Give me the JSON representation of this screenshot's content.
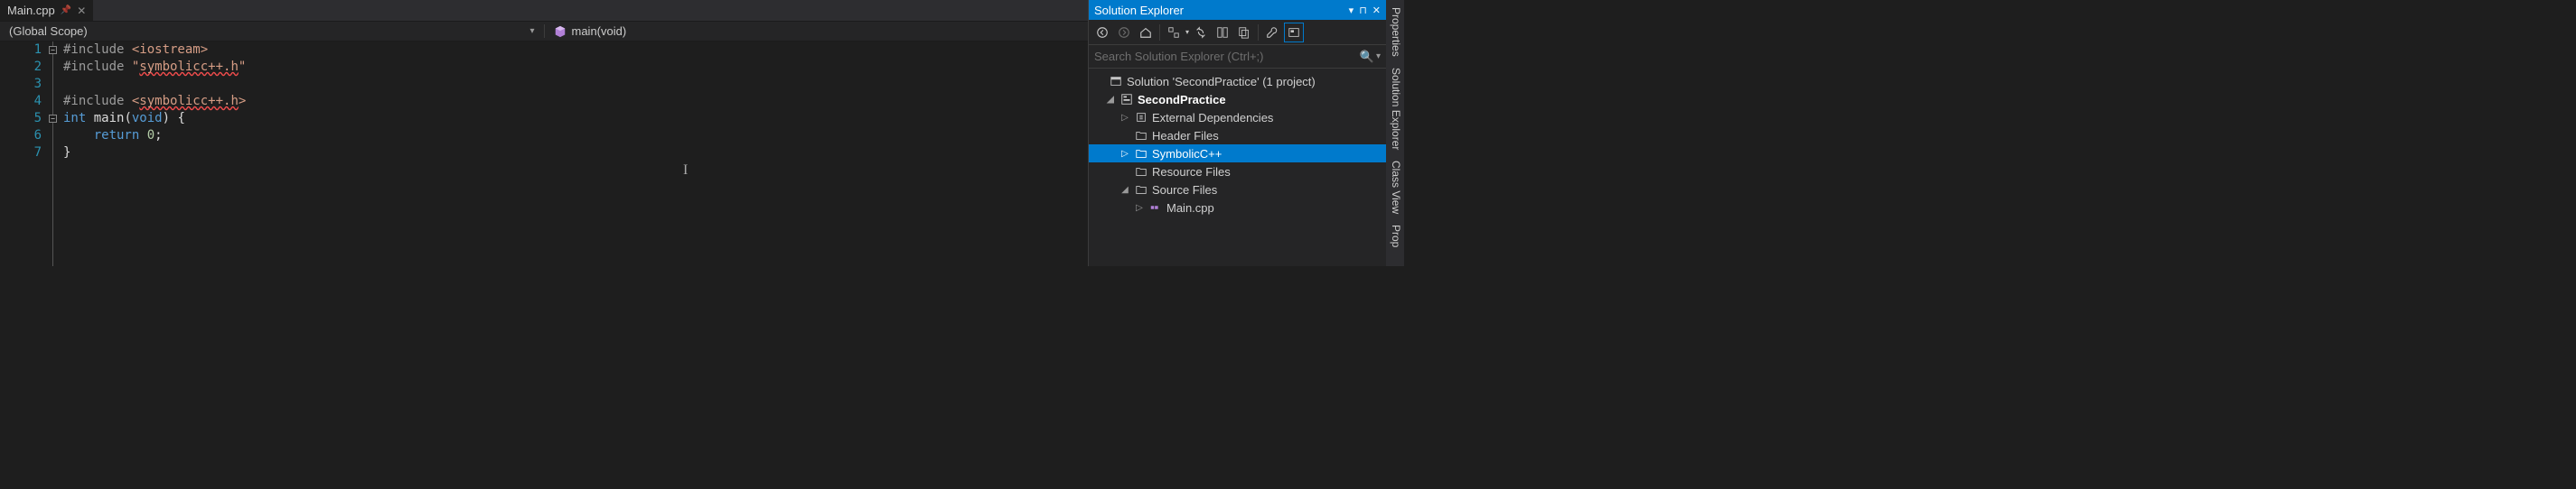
{
  "tab": {
    "filename": "Main.cpp"
  },
  "scope": {
    "left": "(Global Scope)",
    "right": "main(void)"
  },
  "code": {
    "line_numbers": [
      "1",
      "2",
      "3",
      "4",
      "5",
      "6",
      "7"
    ],
    "lines": [
      {
        "segments": [
          {
            "t": "#include ",
            "cls": "pp"
          },
          {
            "t": "<iostream>",
            "cls": "str"
          }
        ]
      },
      {
        "segments": [
          {
            "t": "#include ",
            "cls": "pp"
          },
          {
            "t": "\"",
            "cls": "str"
          },
          {
            "t": "symbolicc++.h",
            "cls": "str err-underline"
          },
          {
            "t": "\"",
            "cls": "str"
          }
        ]
      },
      {
        "segments": []
      },
      {
        "segments": [
          {
            "t": "#include ",
            "cls": "pp"
          },
          {
            "t": "<",
            "cls": "str"
          },
          {
            "t": "symbolicc++.h",
            "cls": "str err-underline"
          },
          {
            "t": ">",
            "cls": "str"
          }
        ]
      },
      {
        "segments": [
          {
            "t": "int",
            "cls": "kw"
          },
          {
            "t": " main(",
            "cls": "plain"
          },
          {
            "t": "void",
            "cls": "kw"
          },
          {
            "t": ") {",
            "cls": "plain"
          }
        ]
      },
      {
        "segments": [
          {
            "t": "    ",
            "cls": "plain"
          },
          {
            "t": "return",
            "cls": "kw"
          },
          {
            "t": " ",
            "cls": "plain"
          },
          {
            "t": "0",
            "cls": "num"
          },
          {
            "t": ";",
            "cls": "plain"
          }
        ]
      },
      {
        "segments": [
          {
            "t": "}",
            "cls": "plain"
          }
        ]
      }
    ]
  },
  "panel": {
    "title": "Solution Explorer",
    "search_placeholder": "Search Solution Explorer (Ctrl+;)"
  },
  "tree": {
    "root": "Solution 'SecondPractice' (1 project)",
    "project": "SecondPractice",
    "items": {
      "ext_deps": "External Dependencies",
      "header_files": "Header Files",
      "symbolic": "SymbolicC++",
      "resource_files": "Resource Files",
      "source_files": "Source Files",
      "main_cpp": "Main.cpp"
    }
  },
  "side_tabs": {
    "properties": "Properties",
    "solution_explorer": "Solution Explorer",
    "class_view": "Class View",
    "prop_short": "Prop"
  }
}
